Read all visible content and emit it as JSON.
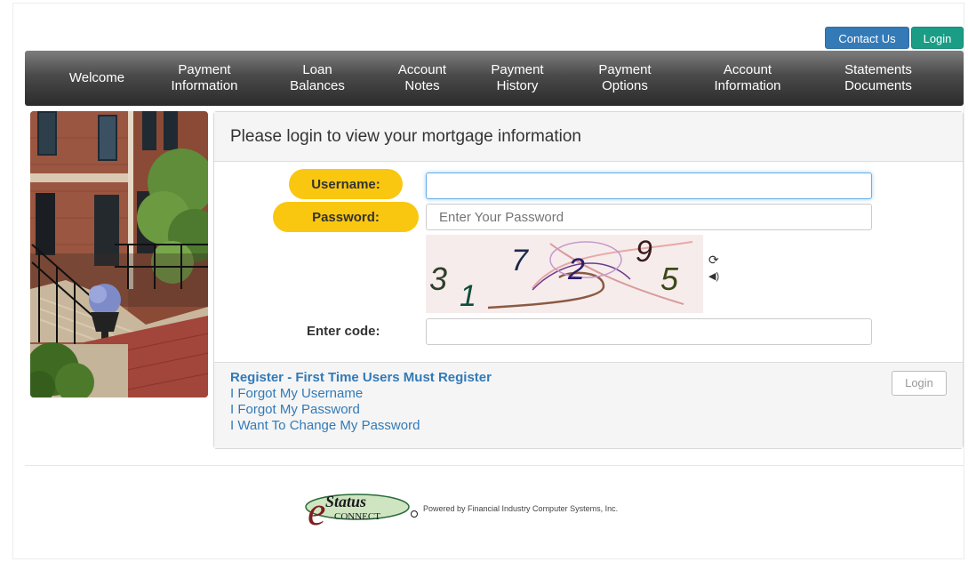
{
  "header": {
    "contact_label": "Contact Us",
    "login_label": "Login"
  },
  "nav": {
    "items": [
      {
        "label": "Welcome"
      },
      {
        "label": "Payment\nInformation"
      },
      {
        "label": "Loan\nBalances"
      },
      {
        "label": "Account\nNotes"
      },
      {
        "label": "Payment\nHistory"
      },
      {
        "label": "Payment\nOptions"
      },
      {
        "label": "Account\nInformation"
      },
      {
        "label": "Statements\nDocuments"
      }
    ]
  },
  "login_panel": {
    "title": "Please login to view your mortgage information",
    "username_label": "Username:",
    "username_value": "",
    "password_label": "Password:",
    "password_placeholder": "Enter Your Password",
    "captcha_digits": [
      "3",
      "1",
      "7",
      "2",
      "9",
      "5"
    ],
    "refresh_icon": "refresh-icon",
    "audio_icon": "audio-icon",
    "code_label": "Enter code:",
    "code_value": ""
  },
  "links": {
    "register": "Register - First Time Users Must Register",
    "forgot_username": "I Forgot My Username",
    "forgot_password": "I Forgot My Password",
    "change_password": "I Want To Change My Password"
  },
  "login_button_label": "Login",
  "footer": {
    "logo_text": "Status",
    "logo_sub": "CONNECT",
    "powered_by": "Powered by Financial Industry Computer Systems, Inc."
  },
  "colors": {
    "highlight": "#f9c710",
    "link": "#337ab7",
    "contact_button": "#337ab7",
    "login_button": "#1a9c85"
  }
}
